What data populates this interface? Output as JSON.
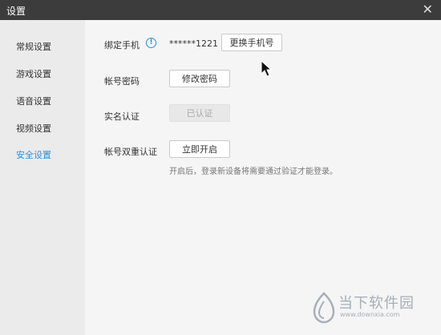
{
  "window": {
    "title": "设置",
    "close_glyph": "✕"
  },
  "sidebar": {
    "items": [
      {
        "label": "常规设置",
        "active": false
      },
      {
        "label": "游戏设置",
        "active": false
      },
      {
        "label": "语音设置",
        "active": false
      },
      {
        "label": "视频设置",
        "active": false
      },
      {
        "label": "安全设置",
        "active": true
      }
    ]
  },
  "security": {
    "phone": {
      "label": "绑定手机",
      "icon": "info-icon",
      "icon_glyph": "!",
      "value": "******1221",
      "button": "更换手机号"
    },
    "password": {
      "label": "帐号密码",
      "button": "修改密码"
    },
    "realname": {
      "label": "实名认证",
      "button": "已认证"
    },
    "two_factor": {
      "label": "帐号双重认证",
      "button": "立即开启",
      "hint": "开启后，登录新设备将需要通过验证才能登录。"
    }
  },
  "watermark": {
    "text": "当下软件园",
    "url": "www.downxia.com"
  },
  "colors": {
    "accent": "#2a8fe0",
    "titlebar": "#3c3c3c",
    "sidebar": "#ebebeb"
  }
}
